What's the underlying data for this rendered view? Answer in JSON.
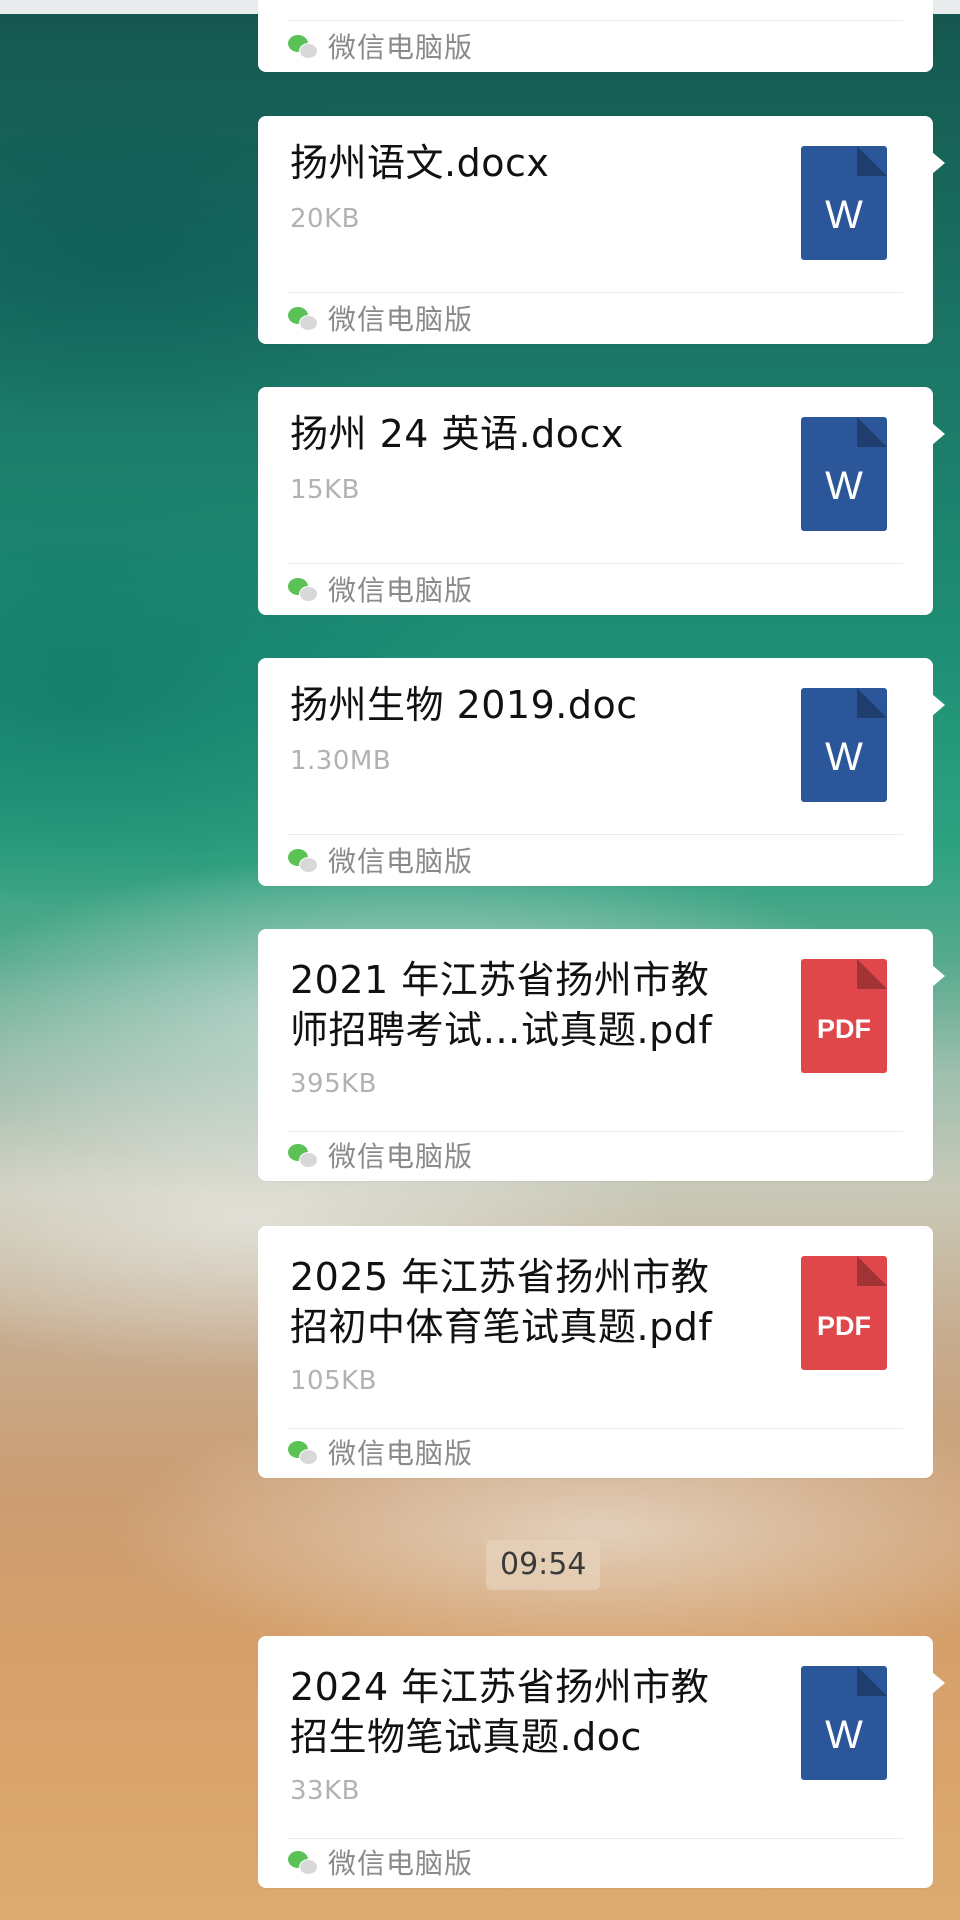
{
  "source_label": "微信电脑版",
  "timestamp": "09:54",
  "messages": [
    {
      "name": "",
      "size": "",
      "type": "partial"
    },
    {
      "name": "扬州语文.docx",
      "size": "20KB",
      "type": "word",
      "icon_label": "W"
    },
    {
      "name": "扬州 24 英语.docx",
      "size": "15KB",
      "type": "word",
      "icon_label": "W"
    },
    {
      "name": "扬州生物 2019.doc",
      "size": "1.30MB",
      "type": "word",
      "icon_label": "W"
    },
    {
      "name_line1": "2021 年江苏省扬州市教",
      "name_line2": "师招聘考试…试真题.pdf",
      "size": "395KB",
      "type": "pdf",
      "icon_label": "PDF"
    },
    {
      "name_line1": "2025 年江苏省扬州市教",
      "name_line2": "招初中体育笔试真题.pdf",
      "size": "105KB",
      "type": "pdf",
      "icon_label": "PDF"
    },
    {
      "name_line1": "2024 年江苏省扬州市教",
      "name_line2": "招生物笔试真题.doc",
      "size": "33KB",
      "type": "word",
      "icon_label": "W"
    }
  ],
  "colors": {
    "word_icon": "#2b579a",
    "pdf_icon": "#e0474a",
    "wechat_green": "#5bc256"
  }
}
